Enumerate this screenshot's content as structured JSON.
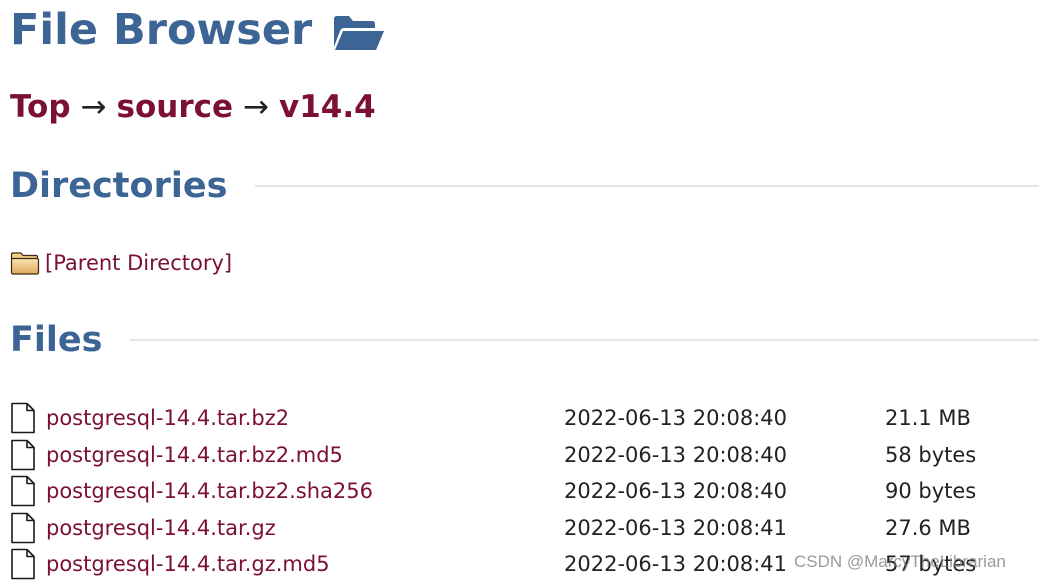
{
  "header": {
    "title": "File Browser",
    "title_icon": "open-folder-icon"
  },
  "breadcrumb": {
    "items": [
      "Top",
      "source",
      "v14.4"
    ],
    "separator": "→"
  },
  "directories": {
    "heading": "Directories",
    "items": [
      {
        "label": "[Parent Directory]",
        "icon": "folder-icon"
      }
    ]
  },
  "files": {
    "heading": "Files",
    "rows": [
      {
        "name": "postgresql-14.4.tar.bz2",
        "modified": "2022-06-13 20:08:40",
        "size": "21.1 MB",
        "icon": "file-icon"
      },
      {
        "name": "postgresql-14.4.tar.bz2.md5",
        "modified": "2022-06-13 20:08:40",
        "size": "58 bytes",
        "icon": "file-icon"
      },
      {
        "name": "postgresql-14.4.tar.bz2.sha256",
        "modified": "2022-06-13 20:08:40",
        "size": "90 bytes",
        "icon": "file-icon"
      },
      {
        "name": "postgresql-14.4.tar.gz",
        "modified": "2022-06-13 20:08:41",
        "size": "27.6 MB",
        "icon": "file-icon"
      },
      {
        "name": "postgresql-14.4.tar.gz.md5",
        "modified": "2022-06-13 20:08:41",
        "size": "57 bytes",
        "icon": "file-icon"
      }
    ]
  },
  "watermark": "CSDN @MarcyTheLibrarian",
  "colors": {
    "heading": "#3c6494",
    "link": "#7b0f34",
    "text": "#222222",
    "rule": "#e4e4e4"
  }
}
